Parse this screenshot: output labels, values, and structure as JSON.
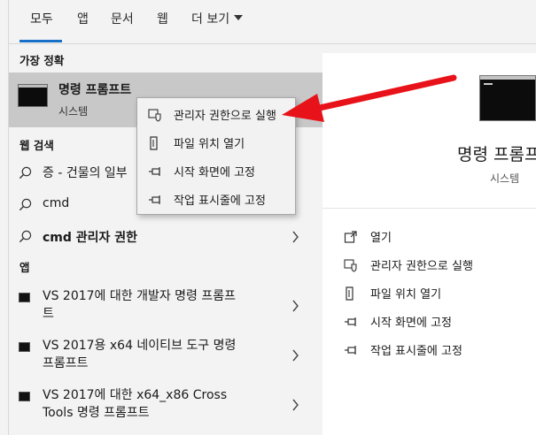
{
  "tabs": [
    {
      "label": "모두"
    },
    {
      "label": "앱"
    },
    {
      "label": "문서"
    },
    {
      "label": "웹"
    },
    {
      "label": "더 보기"
    }
  ],
  "best_match": {
    "header": "가장 정확",
    "title": "명령 프롬프트",
    "subtitle": "시스템"
  },
  "web_search": {
    "header": "웹 검색",
    "items": [
      {
        "text": "증 - 건물의 일부",
        "icon": "search-icon"
      },
      {
        "text": "cmd",
        "icon": "search-icon"
      },
      {
        "text": "cmd 관리자 권한",
        "icon": "search-icon"
      }
    ]
  },
  "apps": {
    "header": "앱",
    "items": [
      {
        "line1": "VS 2017에 대한 개발자 명령 프롬프",
        "line2": "트"
      },
      {
        "line1": "VS 2017용 x64 네이티브 도구 명령",
        "line2": "프롬프트"
      },
      {
        "line1": "VS 2017에 대한 x64_x86 Cross",
        "line2": "Tools 명령 프롬프트"
      }
    ]
  },
  "context_menu": {
    "items": [
      {
        "label": "관리자 권한으로 실행",
        "icon": "shield-icon"
      },
      {
        "label": "파일 위치 열기",
        "icon": "file-location-icon"
      },
      {
        "label": "시작 화면에 고정",
        "icon": "pin-icon"
      },
      {
        "label": "작업 표시줄에 고정",
        "icon": "pin-icon"
      }
    ]
  },
  "detail_panel": {
    "title": "명령 프롬프트",
    "subtitle": "시스템",
    "actions": [
      {
        "label": "열기",
        "icon": "open-icon"
      },
      {
        "label": "관리자 권한으로 실행",
        "icon": "shield-icon"
      },
      {
        "label": "파일 위치 열기",
        "icon": "file-location-icon"
      },
      {
        "label": "시작 화면에 고정",
        "icon": "pin-icon"
      },
      {
        "label": "작업 표시줄에 고정",
        "icon": "pin-icon"
      }
    ]
  },
  "colors": {
    "tab_underline": "#1870c9",
    "best_match_bg": "#c8c8c8",
    "annotation_arrow": "#e8131a"
  }
}
